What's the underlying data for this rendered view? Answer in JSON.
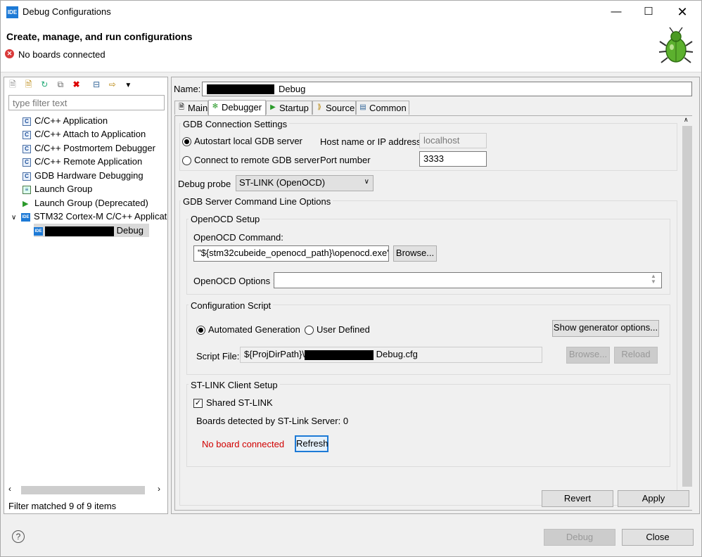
{
  "window": {
    "title": "Debug Configurations",
    "app_icon": "IDE"
  },
  "header": {
    "title": "Create, manage, and run configurations",
    "message": "No boards connected"
  },
  "sidebar": {
    "filter_placeholder": "type filter text",
    "items": [
      {
        "label": "C/C++ Application"
      },
      {
        "label": "C/C++ Attach to Application"
      },
      {
        "label": "C/C++ Postmortem Debugger"
      },
      {
        "label": "C/C++ Remote Application"
      },
      {
        "label": "GDB Hardware Debugging"
      },
      {
        "label": "Launch Group"
      },
      {
        "label": "Launch Group (Deprecated)"
      },
      {
        "label": "STM32 Cortex-M C/C++ Applicat"
      },
      {
        "label": "Debug"
      }
    ],
    "status": "Filter matched 9 of 9 items"
  },
  "config": {
    "name_label": "Name:",
    "name_suffix": "Debug"
  },
  "tabs": [
    {
      "label": "Main"
    },
    {
      "label": "Debugger"
    },
    {
      "label": "Startup"
    },
    {
      "label": "Source"
    },
    {
      "label": "Common"
    }
  ],
  "gdb": {
    "group_title": "GDB Connection Settings",
    "autostart_label": "Autostart local GDB server",
    "remote_label": "Connect to remote GDB server",
    "host_label": "Host name or IP address",
    "host_value": "localhost",
    "port_label": "Port number",
    "port_value": "3333"
  },
  "probe": {
    "label": "Debug probe",
    "value": "ST-LINK (OpenOCD)"
  },
  "server_options": {
    "title": "GDB Server Command Line Options"
  },
  "openocd": {
    "group_title": "OpenOCD Setup",
    "command_label": "OpenOCD Command:",
    "command_value": "\"${stm32cubeide_openocd_path}\\openocd.exe\"",
    "browse_label": "Browse...",
    "options_label": "OpenOCD Options :",
    "options_value": ""
  },
  "script": {
    "group_title": "Configuration Script",
    "auto_label": "Automated Generation",
    "user_label": "User Defined",
    "show_gen_label": "Show generator options...",
    "file_label": "Script File:",
    "file_prefix": "${ProjDirPath}\\",
    "file_suffix": "Debug.cfg",
    "browse_label": "Browse...",
    "reload_label": "Reload"
  },
  "stlink": {
    "group_title": "ST-LINK Client Setup",
    "shared_label": "Shared ST-LINK",
    "boards_detected": "Boards detected by ST-Link Server: 0",
    "no_board": "No board connected",
    "refresh_label": "Refresh"
  },
  "actions": {
    "revert": "Revert",
    "apply": "Apply",
    "debug": "Debug",
    "close": "Close"
  },
  "colors": {
    "error_text": "#d10000",
    "accent": "#1d7ad6"
  }
}
